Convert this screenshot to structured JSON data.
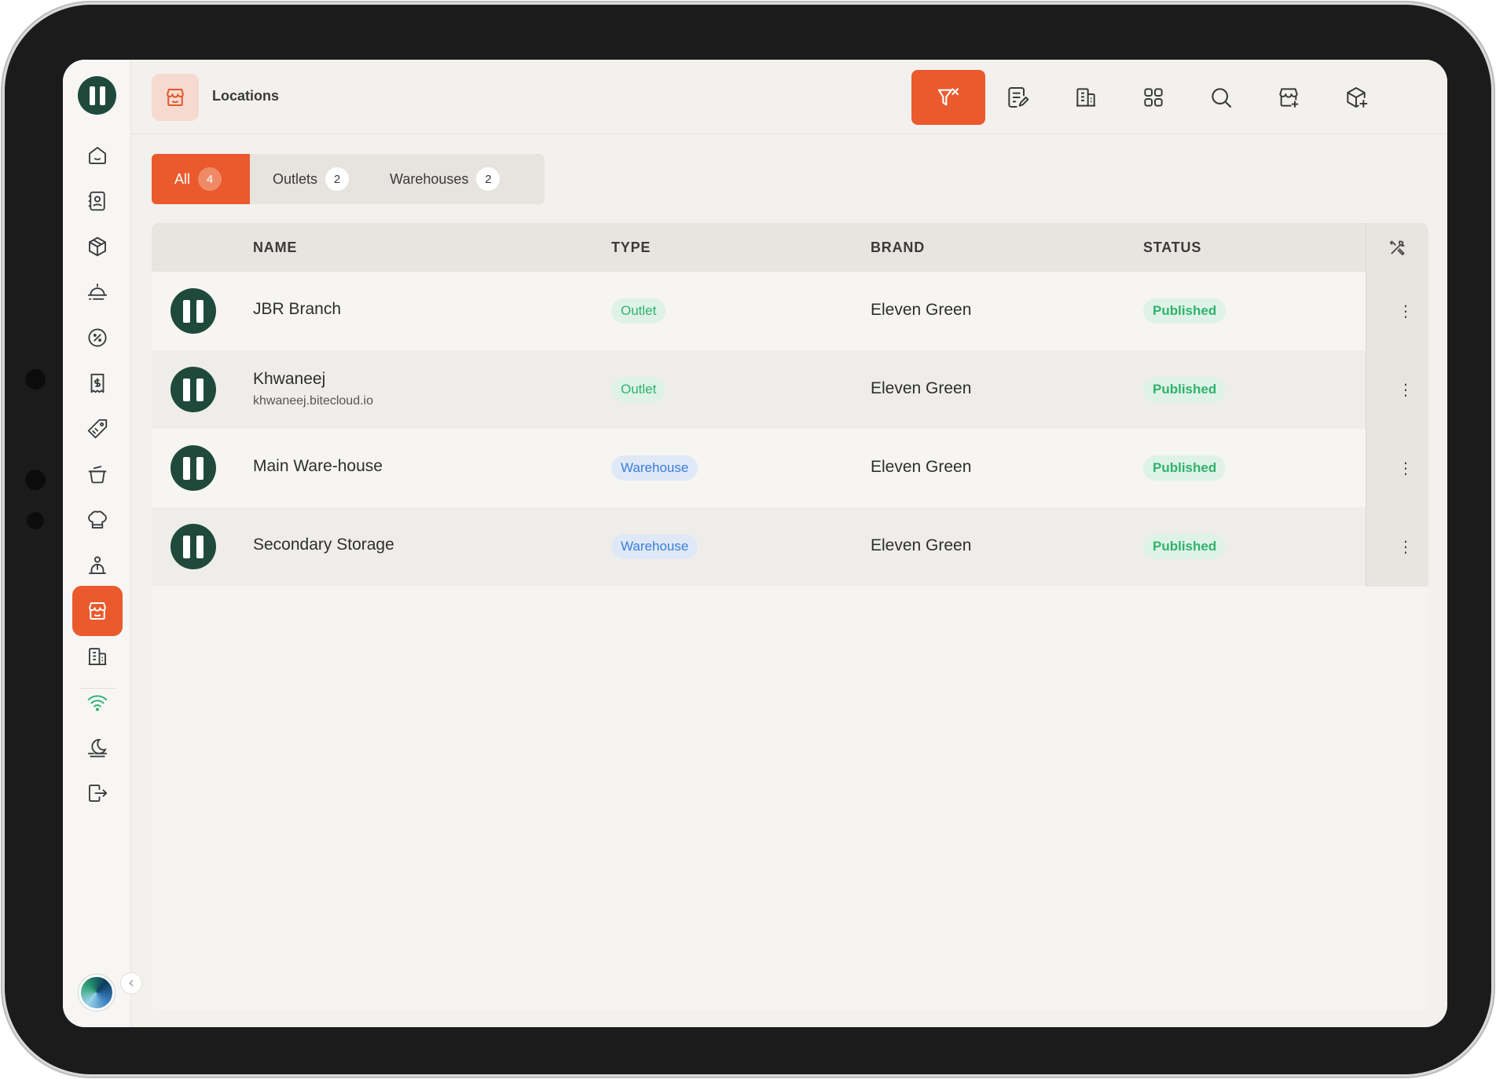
{
  "header": {
    "title": "Locations",
    "page_icon": "store-icon",
    "tools": [
      {
        "name": "clear-filter-icon",
        "active": true
      },
      {
        "name": "note-edit-icon",
        "active": false
      },
      {
        "name": "building-icon",
        "active": false
      },
      {
        "name": "grid-icon",
        "active": false
      },
      {
        "name": "search-icon",
        "active": false
      },
      {
        "name": "store-add-icon",
        "active": false
      },
      {
        "name": "box-add-icon",
        "active": false
      }
    ]
  },
  "sidebar": {
    "items": [
      {
        "icon": "home-icon"
      },
      {
        "icon": "contacts-icon"
      },
      {
        "icon": "box-icon"
      },
      {
        "icon": "delivery-icon"
      },
      {
        "icon": "discount-icon"
      },
      {
        "icon": "receipt-icon"
      },
      {
        "icon": "tag-icon"
      },
      {
        "icon": "pot-icon"
      },
      {
        "icon": "chef-hat-icon"
      },
      {
        "icon": "waiter-icon"
      },
      {
        "icon": "store-icon",
        "active": true
      },
      {
        "icon": "building-icon"
      },
      {
        "icon": "wifi-icon"
      },
      {
        "icon": "theme-icon"
      },
      {
        "icon": "logout-icon"
      }
    ],
    "avatar": "user-avatar",
    "collapse_icon": "chevron-left-icon"
  },
  "tabs": [
    {
      "label": "All",
      "count": "4",
      "active": true
    },
    {
      "label": "Outlets",
      "count": "2",
      "active": false
    },
    {
      "label": "Warehouses",
      "count": "2",
      "active": false
    }
  ],
  "table": {
    "columns": {
      "name": "NAME",
      "type": "TYPE",
      "brand": "BRAND",
      "status": "STATUS"
    },
    "settings_icon": "tools-icon",
    "rows": [
      {
        "name": "JBR Branch",
        "subtitle": "",
        "type": "Outlet",
        "brand": "Eleven Green",
        "status": "Published",
        "menu": "⋮"
      },
      {
        "name": "Khwaneej",
        "subtitle": "khwaneej.bitecloud.io",
        "type": "Outlet",
        "brand": "Eleven Green",
        "status": "Published",
        "menu": "⋮"
      },
      {
        "name": "Main Ware-house",
        "subtitle": "",
        "type": "Warehouse",
        "brand": "Eleven Green",
        "status": "Published",
        "menu": "⋮"
      },
      {
        "name": "Secondary Storage",
        "subtitle": "",
        "type": "Warehouse",
        "brand": "Eleven Green",
        "status": "Published",
        "menu": "⋮"
      }
    ]
  },
  "colors": {
    "accent": "#ea5a2c",
    "brand_green": "#1f4a3b",
    "success": "#2fb36c",
    "info": "#3b7ddd"
  }
}
